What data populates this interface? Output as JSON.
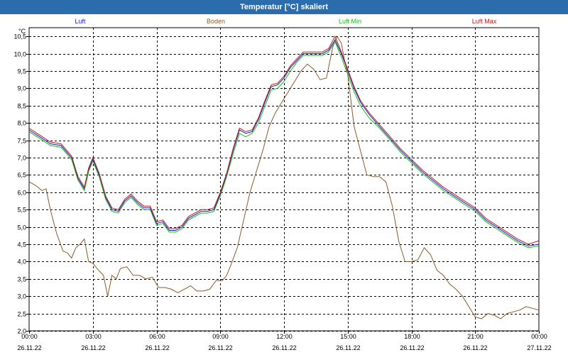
{
  "window": {
    "title": "Temperatur [°C] skaliert"
  },
  "chart_data": {
    "type": "line",
    "title": "Temperatur [°C] skaliert",
    "ylabel": "°C",
    "ylim": [
      2.0,
      10.75
    ],
    "yticks": [
      "2,0",
      "2,5",
      "3,0",
      "3,5",
      "4,0",
      "4,5",
      "5,0",
      "5,5",
      "6,0",
      "6,5",
      "7,0",
      "7,5",
      "8,0",
      "8,5",
      "9,0",
      "9,5",
      "10,0",
      "10,5"
    ],
    "xticks": [
      {
        "time": "00:00",
        "date": "26.11.22"
      },
      {
        "time": "03:00",
        "date": "26.11.22"
      },
      {
        "time": "06:00",
        "date": "26.11.22"
      },
      {
        "time": "09:00",
        "date": "26.11.22"
      },
      {
        "time": "12:00",
        "date": "26.11.22"
      },
      {
        "time": "15:00",
        "date": "26.11.22"
      },
      {
        "time": "18:00",
        "date": "26.11.22"
      },
      {
        "time": "21:00",
        "date": "26.11.22"
      },
      {
        "time": "00:00",
        "date": "27.11.22"
      }
    ],
    "xlim_hours": [
      0,
      24
    ],
    "grid": true,
    "legend_position": "top",
    "series": [
      {
        "name": "Luft",
        "color": "#1a1ad0",
        "x": [
          0,
          0.5,
          1,
          1.5,
          2,
          2.3,
          2.6,
          2.8,
          3,
          3.3,
          3.6,
          3.9,
          4.2,
          4.5,
          4.8,
          5.1,
          5.4,
          5.7,
          6,
          6.3,
          6.6,
          6.9,
          7.2,
          7.5,
          7.8,
          8.1,
          8.4,
          8.7,
          9,
          9.3,
          9.6,
          9.9,
          10.2,
          10.5,
          10.8,
          11.1,
          11.4,
          11.7,
          12,
          12.3,
          12.6,
          12.9,
          13.2,
          13.5,
          13.8,
          14.1,
          14.4,
          14.7,
          15,
          15.3,
          15.6,
          16,
          16.5,
          17,
          17.5,
          18,
          18.5,
          19,
          19.5,
          20,
          20.5,
          21,
          21.5,
          22,
          22.5,
          23,
          23.5,
          24
        ],
        "values": [
          7.8,
          7.6,
          7.4,
          7.35,
          7.0,
          6.4,
          6.1,
          6.65,
          6.95,
          6.5,
          5.85,
          5.5,
          5.45,
          5.75,
          5.9,
          5.7,
          5.55,
          5.55,
          5.1,
          5.15,
          4.9,
          4.9,
          5.0,
          5.25,
          5.35,
          5.45,
          5.45,
          5.5,
          5.95,
          6.5,
          7.2,
          7.8,
          7.7,
          7.75,
          8.1,
          8.6,
          9.05,
          9.1,
          9.3,
          9.6,
          9.8,
          10.0,
          10.0,
          10.0,
          10.0,
          10.1,
          10.4,
          10.0,
          9.5,
          9.0,
          8.6,
          8.25,
          7.9,
          7.55,
          7.2,
          6.9,
          6.6,
          6.35,
          6.1,
          5.9,
          5.7,
          5.5,
          5.2,
          5.0,
          4.8,
          4.6,
          4.45,
          4.5
        ]
      },
      {
        "name": "Boden",
        "color": "#8b5a2b",
        "x": [
          0,
          0.3,
          0.6,
          0.8,
          1,
          1.3,
          1.6,
          1.8,
          2,
          2.2,
          2.4,
          2.6,
          2.8,
          3,
          3.2,
          3.5,
          3.7,
          3.9,
          4.1,
          4.3,
          4.6,
          4.9,
          5.2,
          5.5,
          5.8,
          6.1,
          6.4,
          6.7,
          7.0,
          7.3,
          7.6,
          7.9,
          8.2,
          8.5,
          8.8,
          9.1,
          9.3,
          9.5,
          9.8,
          10.1,
          10.4,
          10.7,
          11.0,
          11.3,
          11.6,
          11.9,
          12.2,
          12.5,
          12.8,
          13.1,
          13.4,
          13.7,
          14.0,
          14.3,
          14.5,
          14.7,
          14.85,
          15.0,
          15.3,
          15.6,
          15.9,
          16.2,
          16.5,
          16.8,
          17.1,
          17.4,
          17.7,
          18.0,
          18.3,
          18.6,
          18.9,
          19.2,
          19.5,
          19.8,
          20.1,
          20.4,
          20.7,
          21.0,
          21.3,
          21.6,
          21.9,
          22.2,
          22.5,
          22.8,
          23.1,
          23.4,
          23.7,
          24
        ],
        "values": [
          6.3,
          6.2,
          6.05,
          6.1,
          5.5,
          4.8,
          4.3,
          4.25,
          4.1,
          4.4,
          4.5,
          4.65,
          4.0,
          3.95,
          3.8,
          3.6,
          3.0,
          3.6,
          3.5,
          3.8,
          3.85,
          3.6,
          3.6,
          3.5,
          3.55,
          3.25,
          3.25,
          3.2,
          3.1,
          3.2,
          3.3,
          3.15,
          3.15,
          3.2,
          3.45,
          3.45,
          3.6,
          3.9,
          4.4,
          5.2,
          6.0,
          6.6,
          7.2,
          7.9,
          8.3,
          8.6,
          8.9,
          9.2,
          9.5,
          9.7,
          9.55,
          9.25,
          9.3,
          10.2,
          10.5,
          10.3,
          9.8,
          9.4,
          7.9,
          7.2,
          6.5,
          6.45,
          6.45,
          6.3,
          5.6,
          4.6,
          4.0,
          4.0,
          4.05,
          4.4,
          4.2,
          3.75,
          3.6,
          3.35,
          3.2,
          3.0,
          2.7,
          2.4,
          2.35,
          2.5,
          2.45,
          2.35,
          2.5,
          2.55,
          2.6,
          2.7,
          2.65,
          2.6
        ]
      },
      {
        "name": "Luft Min",
        "color": "#17b817",
        "x": [
          0,
          0.5,
          1,
          1.5,
          2,
          2.3,
          2.6,
          2.8,
          3,
          3.3,
          3.6,
          3.9,
          4.2,
          4.5,
          4.8,
          5.1,
          5.4,
          5.7,
          6,
          6.3,
          6.6,
          6.9,
          7.2,
          7.5,
          7.8,
          8.1,
          8.4,
          8.7,
          9,
          9.3,
          9.6,
          9.9,
          10.2,
          10.5,
          10.8,
          11.1,
          11.4,
          11.7,
          12,
          12.3,
          12.6,
          12.9,
          13.2,
          13.5,
          13.8,
          14.1,
          14.4,
          14.7,
          15,
          15.3,
          15.6,
          16,
          16.5,
          17,
          17.5,
          18,
          18.5,
          19,
          19.5,
          20,
          20.5,
          21,
          21.5,
          22,
          22.5,
          23,
          23.5,
          24
        ],
        "values": [
          7.75,
          7.55,
          7.35,
          7.3,
          6.95,
          6.35,
          6.05,
          6.6,
          6.9,
          6.45,
          5.8,
          5.45,
          5.4,
          5.7,
          5.85,
          5.65,
          5.5,
          5.5,
          5.05,
          5.1,
          4.85,
          4.85,
          4.95,
          5.2,
          5.3,
          5.4,
          5.4,
          5.45,
          5.9,
          6.45,
          7.1,
          7.7,
          7.6,
          7.7,
          8.0,
          8.5,
          8.95,
          9.0,
          9.2,
          9.5,
          9.75,
          9.95,
          9.95,
          9.95,
          9.95,
          10.05,
          10.35,
          9.9,
          9.4,
          8.9,
          8.5,
          8.15,
          7.85,
          7.5,
          7.15,
          6.85,
          6.55,
          6.3,
          6.05,
          5.85,
          5.65,
          5.45,
          5.15,
          4.95,
          4.75,
          4.55,
          4.4,
          4.45
        ]
      },
      {
        "name": "Luft Max",
        "color": "#c01a1a",
        "x": [
          0,
          0.5,
          1,
          1.5,
          2,
          2.3,
          2.6,
          2.8,
          3,
          3.3,
          3.6,
          3.9,
          4.2,
          4.5,
          4.8,
          5.1,
          5.4,
          5.7,
          6,
          6.3,
          6.6,
          6.9,
          7.2,
          7.5,
          7.8,
          8.1,
          8.4,
          8.7,
          9,
          9.3,
          9.6,
          9.9,
          10.2,
          10.5,
          10.8,
          11.1,
          11.4,
          11.7,
          12,
          12.3,
          12.6,
          12.9,
          13.2,
          13.5,
          13.8,
          14.1,
          14.4,
          14.7,
          15,
          15.3,
          15.6,
          16,
          16.5,
          17,
          17.5,
          18,
          18.5,
          19,
          19.5,
          20,
          20.5,
          21,
          21.5,
          22,
          22.5,
          23,
          23.5,
          24
        ],
        "values": [
          7.85,
          7.65,
          7.45,
          7.4,
          7.05,
          6.45,
          6.15,
          6.7,
          7.0,
          6.55,
          5.9,
          5.55,
          5.5,
          5.8,
          5.95,
          5.75,
          5.6,
          5.6,
          5.15,
          5.2,
          4.95,
          4.95,
          5.05,
          5.3,
          5.4,
          5.5,
          5.5,
          5.55,
          6.0,
          6.55,
          7.25,
          7.85,
          7.75,
          7.8,
          8.15,
          8.65,
          9.1,
          9.15,
          9.35,
          9.65,
          9.85,
          10.05,
          10.05,
          10.05,
          10.05,
          10.15,
          10.5,
          10.05,
          9.55,
          9.05,
          8.65,
          8.3,
          7.95,
          7.6,
          7.25,
          6.95,
          6.65,
          6.4,
          6.15,
          5.95,
          5.75,
          5.55,
          5.25,
          5.05,
          4.85,
          4.65,
          4.5,
          4.6
        ]
      }
    ]
  }
}
